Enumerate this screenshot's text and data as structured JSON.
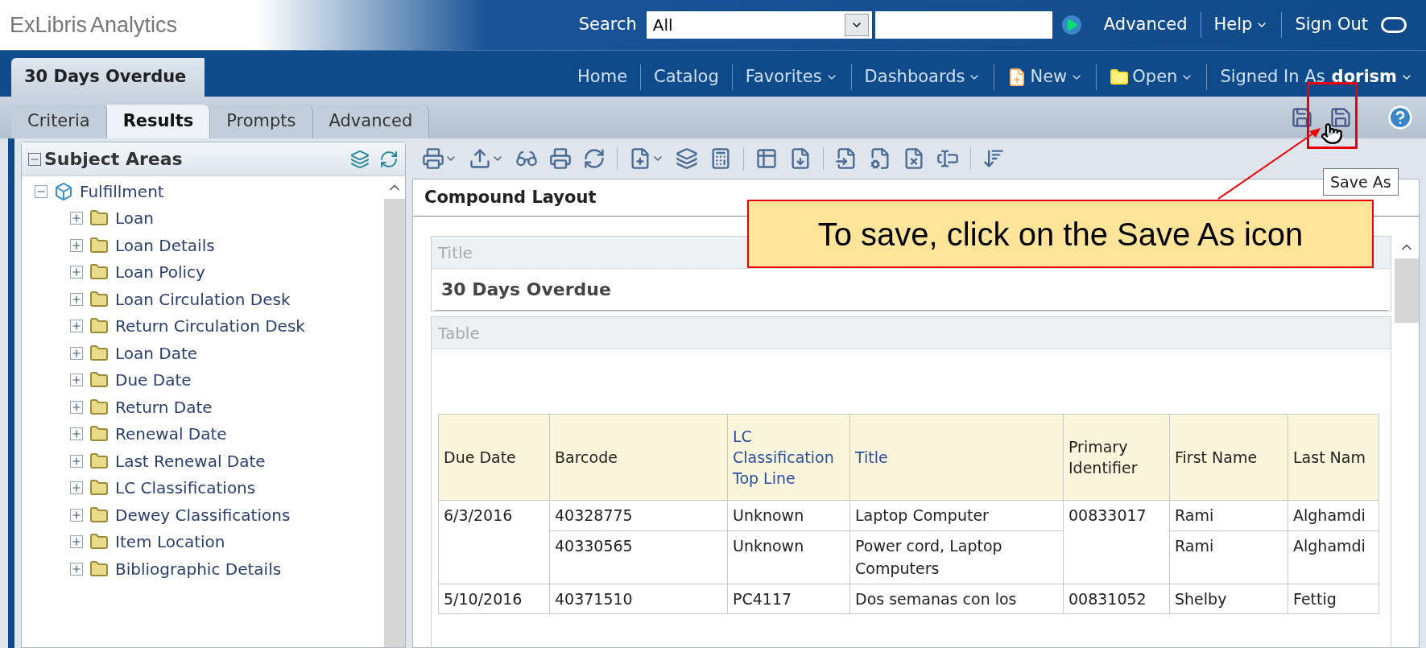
{
  "logo": {
    "brand": "ExLibris",
    "product": "Analytics"
  },
  "search": {
    "label": "Search",
    "scope": "All"
  },
  "header_links": [
    {
      "label": "Advanced",
      "has_menu": false
    },
    {
      "label": "Help",
      "has_menu": true
    },
    {
      "label": "Sign Out",
      "has_menu": false
    }
  ],
  "nav": {
    "title": "30 Days Overdue",
    "links": [
      {
        "label": "Home",
        "kind": "plain",
        "has_menu": false
      },
      {
        "label": "Catalog",
        "kind": "plain",
        "has_menu": false
      },
      {
        "label": "Favorites",
        "kind": "plain",
        "has_menu": true
      },
      {
        "label": "Dashboards",
        "kind": "plain",
        "has_menu": true
      },
      {
        "label": "New",
        "kind": "new",
        "has_menu": true
      },
      {
        "label": "Open",
        "kind": "open",
        "has_menu": true
      }
    ],
    "signed_in": {
      "prefix": "Signed In As",
      "user": "dorism"
    }
  },
  "tabs": [
    {
      "label": "Criteria",
      "selected": false
    },
    {
      "label": "Results",
      "selected": true
    },
    {
      "label": "Prompts",
      "selected": false
    },
    {
      "label": "Advanced",
      "selected": false
    }
  ],
  "tooltip": "Save As",
  "subject_areas": {
    "title": "Subject Areas",
    "tree": [
      {
        "label": "Fulfillment",
        "expanded": true,
        "children": [
          {
            "label": "Loan",
            "expanded": false
          },
          {
            "label": "Loan Details",
            "expanded": false
          },
          {
            "label": "Loan Policy",
            "expanded": false
          },
          {
            "label": "Loan Circulation Desk",
            "expanded": false
          },
          {
            "label": "Return Circulation Desk",
            "expanded": false
          },
          {
            "label": "Loan Date",
            "expanded": false
          },
          {
            "label": "Due Date",
            "expanded": false
          },
          {
            "label": "Return Date",
            "expanded": false
          },
          {
            "label": "Renewal Date",
            "expanded": false
          },
          {
            "label": "Last Renewal Date",
            "expanded": false
          },
          {
            "label": "LC Classifications",
            "expanded": false
          },
          {
            "label": "Dewey Classifications",
            "expanded": false
          },
          {
            "label": "Item Location",
            "expanded": false
          },
          {
            "label": "Bibliographic Details",
            "expanded": false
          }
        ]
      }
    ]
  },
  "editor": {
    "title": "Compound Layout",
    "views": [
      {
        "kind": "title",
        "label": "Title",
        "content": "30 Days Overdue"
      },
      {
        "kind": "table",
        "label": "Table"
      }
    ]
  },
  "table": {
    "columns": [
      {
        "label": "Due Date",
        "sortable": false
      },
      {
        "label": "Barcode",
        "sortable": false
      },
      {
        "label": "LC Classification Top Line",
        "sortable": true
      },
      {
        "label": "Title",
        "sortable": true
      },
      {
        "label": "Primary Identifier",
        "sortable": false
      },
      {
        "label": "First Name",
        "sortable": false
      },
      {
        "label": "Last Nam",
        "sortable": false
      }
    ],
    "groups": [
      {
        "due_date": "6/3/2016",
        "primary_identifier": "00833017",
        "items": [
          {
            "barcode": "40328775",
            "lc": "Unknown",
            "title": "Laptop Computer",
            "first_name": "Rami",
            "last_name": "Alghamdi"
          },
          {
            "barcode": "40330565",
            "lc": "Unknown",
            "title": "Power cord, Laptop Computers",
            "first_name": "Rami",
            "last_name": "Alghamdi"
          }
        ]
      },
      {
        "due_date": "5/10/2016",
        "primary_identifier": "00831052",
        "items": [
          {
            "barcode": "40371510",
            "lc": "PC4117",
            "title": "Dos semanas con los",
            "first_name": "Shelby",
            "last_name": "Fettig"
          }
        ]
      }
    ]
  },
  "callout": "To save, click on the Save As icon"
}
